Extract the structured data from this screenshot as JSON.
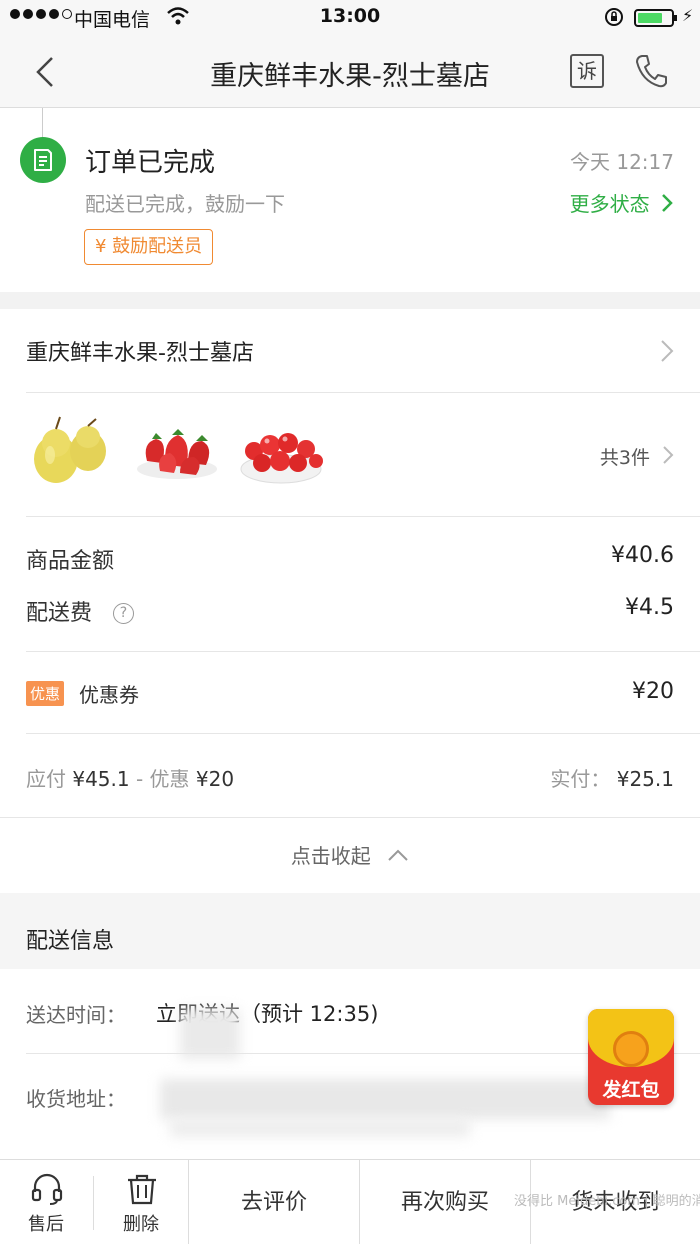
{
  "status_bar": {
    "carrier": "中国电信",
    "time": "13:00",
    "battery_level": 0.75
  },
  "nav": {
    "title": "重庆鲜丰水果-烈士墓店",
    "complain_label": "诉"
  },
  "order_status": {
    "title": "订单已完成",
    "time": "今天 12:17",
    "subtitle": "配送已完成，鼓励一下",
    "more_label": "更多状态",
    "cheer_button": "¥ 鼓励配送员"
  },
  "order": {
    "shop_name": "重庆鲜丰水果-烈士墓店",
    "goods_count": "共3件",
    "items": [
      "pear",
      "strawberry",
      "cherry-tomato"
    ],
    "goods_amount_label": "商品金额",
    "goods_amount": "¥40.6",
    "delivery_fee_label": "配送费",
    "delivery_fee": "¥4.5",
    "coupon_badge": "优惠",
    "coupon_label": "优惠券",
    "coupon_value": "¥20",
    "payable_label": "应付",
    "payable_value": "¥45.1",
    "discount_label": "- 优惠",
    "discount_value": "¥20",
    "actual_label": "实付：",
    "actual_value": "¥25.1",
    "collapse_label": "点击收起"
  },
  "delivery": {
    "header": "配送信息",
    "time_label": "送达时间：",
    "time_value": "立即送达（预计 12:35)",
    "address_label": "收货地址："
  },
  "redpack": {
    "label": "发红包"
  },
  "bottom_bar": {
    "after_sale": "售后",
    "delete": "删除",
    "review": "去评价",
    "rebuy": "再次购买",
    "not_received": "货未收到"
  },
  "watermark": "没得比 Meidebi.com  |  聪明的消费者"
}
